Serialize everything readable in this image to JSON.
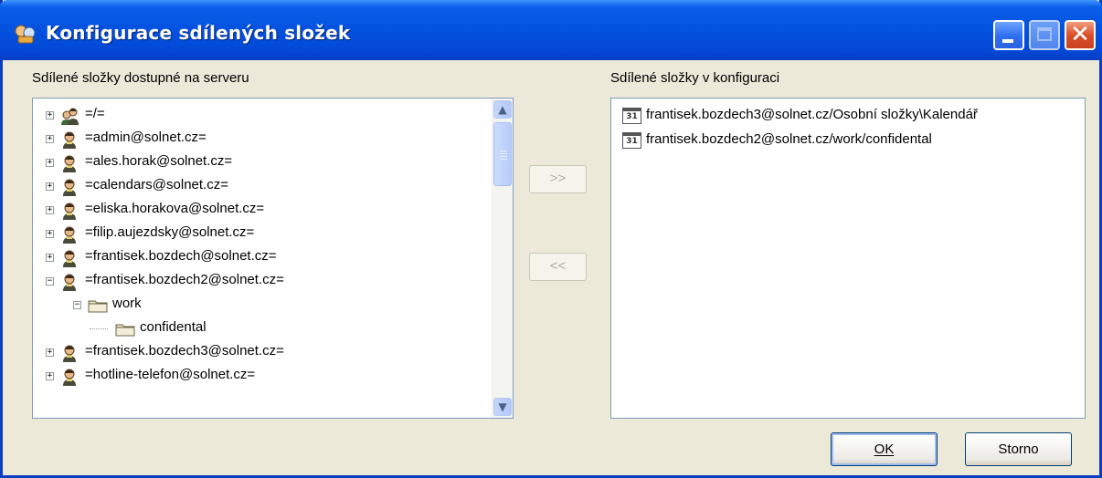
{
  "window": {
    "title": "Konfigurace sdílených složek",
    "accent": "#0453e0"
  },
  "left_panel": {
    "label": "Sdílené složky dostupné na serveru",
    "items": [
      {
        "label": "=/=",
        "icon": "users-icon",
        "expander": "+"
      },
      {
        "label": "=admin@solnet.cz=",
        "icon": "user-icon",
        "expander": "+"
      },
      {
        "label": "=ales.horak@solnet.cz=",
        "icon": "user-icon",
        "expander": "+"
      },
      {
        "label": "=calendars@solnet.cz=",
        "icon": "user-icon",
        "expander": "+"
      },
      {
        "label": "=eliska.horakova@solnet.cz=",
        "icon": "user-icon",
        "expander": "+"
      },
      {
        "label": "=filip.aujezdsky@solnet.cz=",
        "icon": "user-icon",
        "expander": "+"
      },
      {
        "label": "=frantisek.bozdech@solnet.cz=",
        "icon": "user-icon",
        "expander": "+"
      },
      {
        "label": "=frantisek.bozdech2@solnet.cz=",
        "icon": "user-icon",
        "expander": "−"
      },
      {
        "label": "work",
        "icon": "folder-icon",
        "expander": "−"
      },
      {
        "label": "confidental",
        "icon": "folder-icon",
        "expander": ""
      },
      {
        "label": "=frantisek.bozdech3@solnet.cz=",
        "icon": "user-icon",
        "expander": "+"
      },
      {
        "label": "=hotline-telefon@solnet.cz=",
        "icon": "user-icon",
        "expander": "+"
      }
    ]
  },
  "move_buttons": {
    "add_label": ">>",
    "remove_label": "<<"
  },
  "right_panel": {
    "label": "Sdílené složky v konfiguraci",
    "items": [
      {
        "label": "frantisek.bozdech3@solnet.cz/Osobní složky\\Kalendář",
        "icon": "calendar-icon",
        "icon_text": "31"
      },
      {
        "label": "frantisek.bozdech2@solnet.cz/work/confidental",
        "icon": "calendar-icon",
        "icon_text": "31"
      }
    ]
  },
  "footer": {
    "ok_label": "OK",
    "cancel_label": "Storno"
  }
}
